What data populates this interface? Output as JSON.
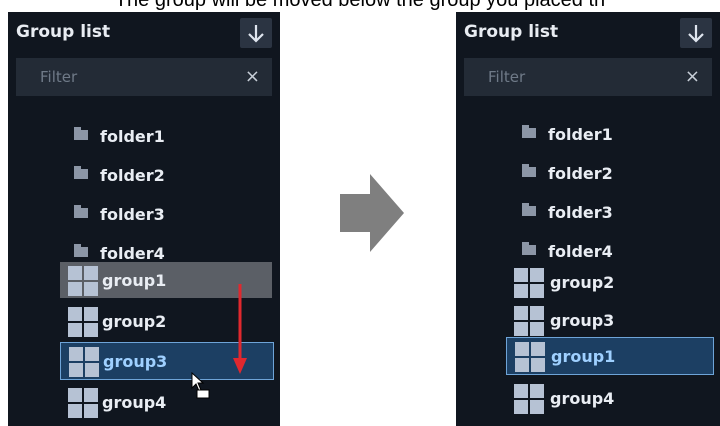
{
  "caption": "The group will be moved below the group you placed th",
  "left_panel": {
    "title": "Group list",
    "filter_placeholder": "Filter",
    "filter_clear": "×",
    "items": [
      {
        "label": "folder1",
        "type": "folder"
      },
      {
        "label": "folder2",
        "type": "folder"
      },
      {
        "label": "folder3",
        "type": "folder"
      },
      {
        "label": "folder4",
        "type": "folder"
      },
      {
        "label": "group1",
        "type": "group",
        "state": "dragging"
      },
      {
        "label": "group2",
        "type": "group"
      },
      {
        "label": "group3",
        "type": "group",
        "state": "drop-target"
      },
      {
        "label": "group4",
        "type": "group"
      }
    ]
  },
  "right_panel": {
    "title": "Group list",
    "filter_placeholder": "Filter",
    "filter_clear": "×",
    "items": [
      {
        "label": "folder1",
        "type": "folder"
      },
      {
        "label": "folder2",
        "type": "folder"
      },
      {
        "label": "folder3",
        "type": "folder"
      },
      {
        "label": "folder4",
        "type": "folder"
      },
      {
        "label": "group2",
        "type": "group"
      },
      {
        "label": "group3",
        "type": "group"
      },
      {
        "label": "group1",
        "type": "group",
        "state": "selected"
      },
      {
        "label": "group4",
        "type": "group"
      }
    ]
  },
  "colors": {
    "panel_bg": "#10161f",
    "header_button": "#2b3442",
    "filter_bg": "#232b36",
    "drag_highlight": "#5b5f66",
    "selected_bg": "#1c3f63",
    "selected_border": "#6ea4d8",
    "drag_arrow": "#e0282e",
    "transition_arrow": "#7f7f7f"
  },
  "icons": [
    "download-arrow-icon",
    "close-icon",
    "folder-icon",
    "group-grid-icon",
    "drag-cursor-icon",
    "right-arrow-icon"
  ]
}
